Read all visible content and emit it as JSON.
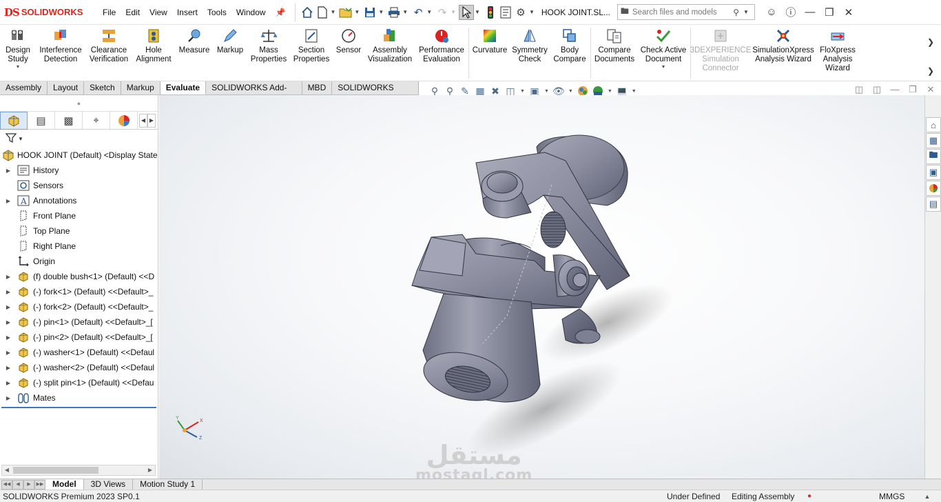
{
  "brand": {
    "mark": "DS",
    "name": "SOLIDWORKS"
  },
  "menu": [
    "File",
    "Edit",
    "View",
    "Insert",
    "Tools",
    "Window"
  ],
  "document_title": "HOOK JOINT.SL...",
  "search": {
    "placeholder": "Search files and models"
  },
  "command_buttons": [
    {
      "id": "design-study",
      "label1": "Design",
      "label2": "Study",
      "dropdown": true
    },
    {
      "id": "interference-detection",
      "label1": "Interference",
      "label2": "Detection"
    },
    {
      "id": "clearance-verification",
      "label1": "Clearance",
      "label2": "Verification"
    },
    {
      "id": "hole-alignment",
      "label1": "Hole",
      "label2": "Alignment"
    },
    {
      "id": "measure",
      "label1": "Measure",
      "label2": ""
    },
    {
      "id": "markup",
      "label1": "Markup",
      "label2": ""
    },
    {
      "id": "mass-properties",
      "label1": "Mass",
      "label2": "Properties"
    },
    {
      "id": "section-properties",
      "label1": "Section",
      "label2": "Properties"
    },
    {
      "id": "sensor",
      "label1": "Sensor",
      "label2": ""
    },
    {
      "id": "assembly-visualization",
      "label1": "Assembly",
      "label2": "Visualization"
    },
    {
      "id": "performance-evaluation",
      "label1": "Performance",
      "label2": "Evaluation"
    },
    {
      "id": "curvature",
      "label1": "Curvature",
      "label2": ""
    },
    {
      "id": "symmetry-check",
      "label1": "Symmetry",
      "label2": "Check"
    },
    {
      "id": "body-compare",
      "label1": "Body",
      "label2": "Compare"
    },
    {
      "id": "compare-documents",
      "label1": "Compare",
      "label2": "Documents"
    },
    {
      "id": "check-active-document",
      "label1": "Check Active",
      "label2": "Document",
      "dropdown": true
    },
    {
      "id": "3dexperience-simulation-connector",
      "label1": "3DEXPERIENCE",
      "label2": "Simulation",
      "label3": "Connector",
      "disabled": true
    },
    {
      "id": "simulationxpress",
      "label1": "SimulationXpress",
      "label2": "Analysis Wizard"
    },
    {
      "id": "floxpress",
      "label1": "FloXpress",
      "label2": "Analysis",
      "label3": "Wizard"
    }
  ],
  "tabs": [
    "Assembly",
    "Layout",
    "Sketch",
    "Markup",
    "Evaluate",
    "SOLIDWORKS Add-Ins",
    "MBD",
    "SOLIDWORKS CAM"
  ],
  "active_tab": "Evaluate",
  "feature_tree": {
    "root": "HOOK JOINT (Default) <Display State-",
    "items": [
      {
        "label": "History",
        "icon": "history-folder-icon",
        "expand": true
      },
      {
        "label": "Sensors",
        "icon": "sensors-icon",
        "expand": false
      },
      {
        "label": "Annotations",
        "icon": "annotations-icon",
        "expand": true
      },
      {
        "label": "Front Plane",
        "icon": "plane-icon",
        "expand": false
      },
      {
        "label": "Top Plane",
        "icon": "plane-icon",
        "expand": false
      },
      {
        "label": "Right Plane",
        "icon": "plane-icon",
        "expand": false
      },
      {
        "label": "Origin",
        "icon": "origin-icon",
        "expand": false
      },
      {
        "label": "(f) double bush<1> (Default) <<D",
        "icon": "part-icon",
        "expand": true
      },
      {
        "label": "(-) fork<1> (Default) <<Default>_",
        "icon": "part-icon",
        "expand": true
      },
      {
        "label": "(-) fork<2> (Default) <<Default>_",
        "icon": "part-icon",
        "expand": true
      },
      {
        "label": "(-) pin<1> (Default) <<Default>_[",
        "icon": "part-icon",
        "expand": true
      },
      {
        "label": "(-) pin<2> (Default) <<Default>_[",
        "icon": "part-icon",
        "expand": true
      },
      {
        "label": "(-) washer<1> (Default) <<Defaul",
        "icon": "part-icon",
        "expand": true
      },
      {
        "label": "(-) washer<2> (Default) <<Defaul",
        "icon": "part-icon",
        "expand": true
      },
      {
        "label": "(-) split pin<1> (Default) <<Defau",
        "icon": "part-icon",
        "expand": true
      },
      {
        "label": "Mates",
        "icon": "mates-icon",
        "expand": true
      }
    ]
  },
  "triad": {
    "x": "X",
    "y": "Y",
    "z": "Z"
  },
  "watermark": {
    "arabic": "مستقل",
    "latin": "mostaql.com"
  },
  "bottom_tabs": [
    "Model",
    "3D Views",
    "Motion Study 1"
  ],
  "active_bottom_tab": "Model",
  "status": {
    "product": "SOLIDWORKS Premium 2023 SP0.1",
    "definition": "Under Defined",
    "mode": "Editing Assembly",
    "units": "MMGS"
  }
}
